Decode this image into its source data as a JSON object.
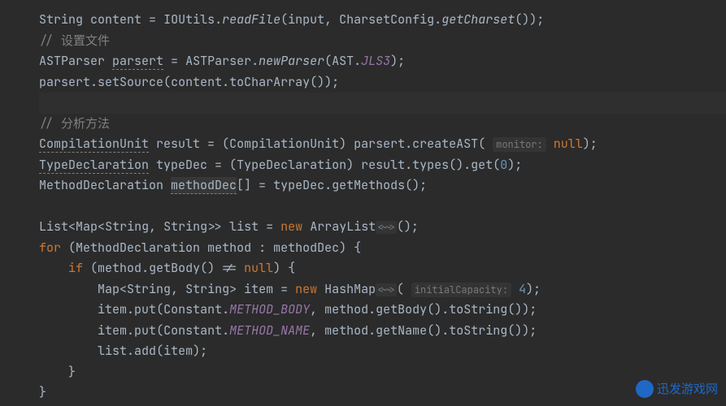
{
  "code": {
    "line1": {
      "type1": "String",
      "var1": "content",
      "class1": "IOUtils",
      "method1": "readFile",
      "arg1": "input",
      "class2": "CharsetConfig",
      "method2": "getCharset"
    },
    "line2": {
      "comment": "// 设置文件"
    },
    "line3": {
      "type": "ASTParser",
      "var": "parsert",
      "class": "ASTParser",
      "method": "newParser",
      "argClass": "AST",
      "argField": "JLS3"
    },
    "line4": {
      "obj": "parsert",
      "method1": "setSource",
      "arg": "content",
      "method2": "toCharArray"
    },
    "line6": {
      "comment": "// 分析方法"
    },
    "line7": {
      "type": "CompilationUnit",
      "var": "result",
      "cast": "CompilationUnit",
      "obj": "parsert",
      "method": "createAST",
      "hint": "monitor:",
      "arg": "null"
    },
    "line8": {
      "type": "TypeDeclaration",
      "var": "typeDec",
      "cast": "TypeDeclaration",
      "obj": "result",
      "method1": "types",
      "method2": "get",
      "arg": "0"
    },
    "line9": {
      "type": "MethodDeclaration",
      "var": "methodDec",
      "obj": "typeDec",
      "method": "getMethods"
    },
    "line11": {
      "type": "List",
      "gen1": "Map",
      "gen2": "String",
      "gen3": "String",
      "var": "list",
      "kw": "new",
      "ctor": "ArrayList",
      "diamond": "<~>"
    },
    "line12": {
      "kw": "for",
      "type": "MethodDeclaration",
      "var": "method",
      "iter": "methodDec"
    },
    "line13": {
      "kw": "if",
      "obj": "method",
      "method": "getBody",
      "op": "!=",
      "val": "null"
    },
    "line14": {
      "type": "Map",
      "gen1": "String",
      "gen2": "String",
      "var": "item",
      "kw": "new",
      "ctor": "HashMap",
      "diamond": "<~>",
      "hint": "initialCapacity:",
      "arg": "4"
    },
    "line15": {
      "obj": "item",
      "method1": "put",
      "class": "Constant",
      "field": "METHOD_BODY",
      "arg": "method",
      "method2": "getBody",
      "method3": "toString"
    },
    "line16": {
      "obj": "item",
      "method1": "put",
      "class": "Constant",
      "field": "METHOD_NAME",
      "arg": "method",
      "method2": "getName",
      "method3": "toString"
    },
    "line17": {
      "obj": "list",
      "method": "add",
      "arg": "item"
    },
    "brace_close": "}"
  },
  "watermark": {
    "text": "迅发游戏网"
  }
}
